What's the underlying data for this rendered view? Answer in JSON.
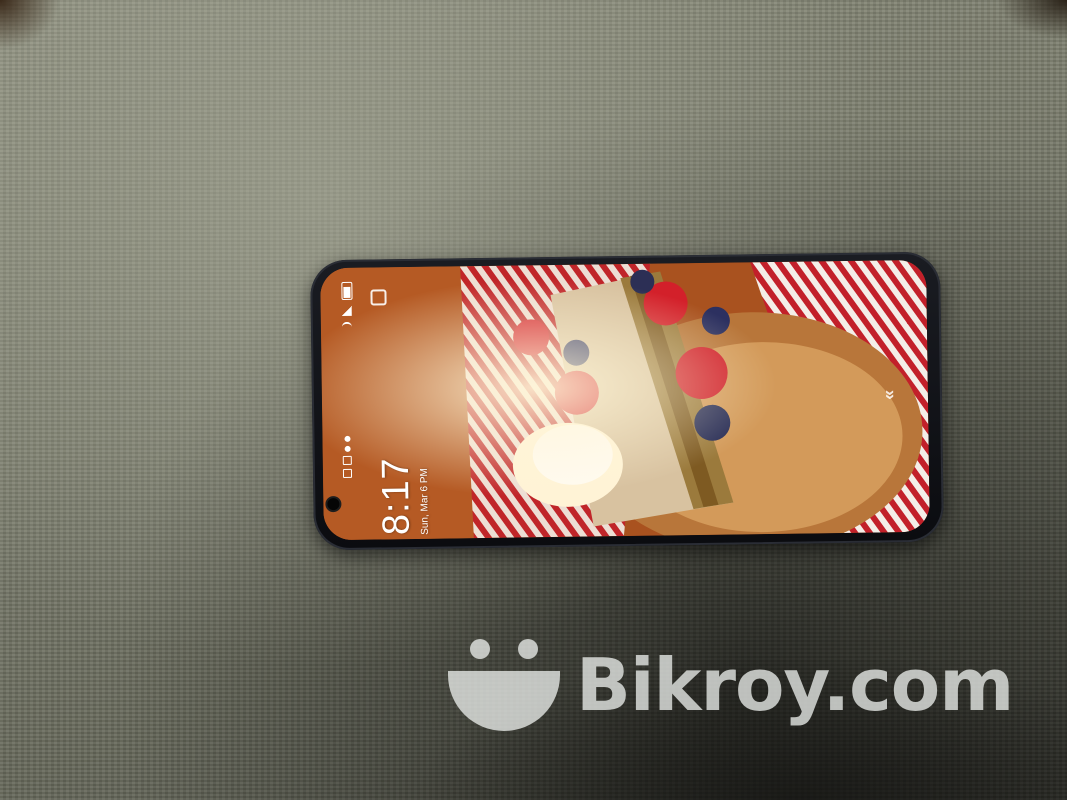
{
  "lockscreen": {
    "time": "8:17",
    "date": "Sun, Mar 6  PM"
  },
  "icons": {
    "battery": "battery-icon",
    "signal": "signal-icon",
    "wifi": "wifi-icon",
    "camera": "front-camera-icon",
    "swipe": "swipe-up-chevron-icon"
  },
  "swipe_hint": "«",
  "watermark": {
    "text": "Bikroy.com"
  },
  "colors": {
    "fabric": "#7b7d6d",
    "phone_frame": "#0b0c10",
    "watermark": "#e9ece9",
    "stripe_red": "#c2202a"
  }
}
